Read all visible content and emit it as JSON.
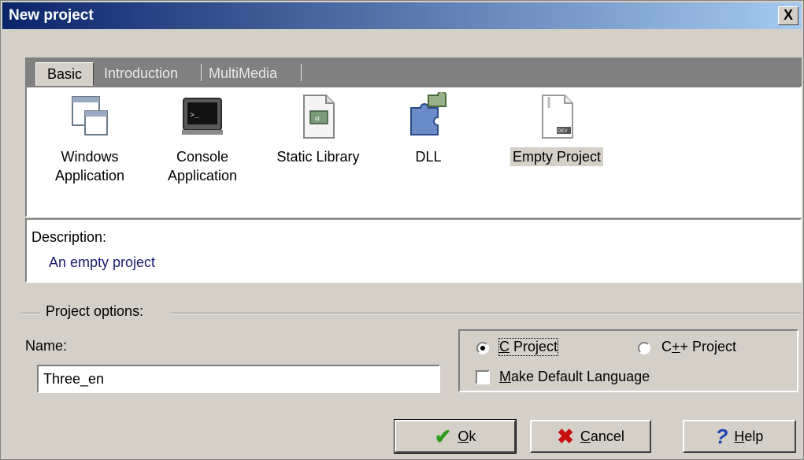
{
  "window": {
    "title": "New project",
    "close_label": "X"
  },
  "tabs": [
    {
      "label": "Basic",
      "active": true
    },
    {
      "label": "Introduction",
      "active": false
    },
    {
      "label": "MultiMedia",
      "active": false
    }
  ],
  "templates": [
    {
      "line1": "Windows",
      "line2": "Application",
      "icon": "window-icon",
      "selected": false
    },
    {
      "line1": "Console",
      "line2": "Application",
      "icon": "console-icon",
      "selected": false
    },
    {
      "line1": "Static Library",
      "line2": "",
      "icon": "library-icon",
      "selected": false
    },
    {
      "line1": "DLL",
      "line2": "",
      "icon": "puzzle-icon",
      "selected": false
    },
    {
      "line1": "Empty Project",
      "line2": "",
      "icon": "dev-file-icon",
      "selected": true
    }
  ],
  "description": {
    "label": "Description:",
    "value": "An empty project"
  },
  "options": {
    "group_label": "Project options:",
    "name_label": "Name:",
    "name_value": "Three_en",
    "c_project": {
      "prefix": "",
      "key": "C",
      "rest": " Project",
      "checked": true
    },
    "cpp_project": {
      "prefix": "C",
      "key": "+",
      "rest": "+ Project",
      "checked": false
    },
    "default_lang": {
      "prefix": "",
      "key": "M",
      "rest": "ake Default Language",
      "checked": false
    }
  },
  "buttons": {
    "ok": {
      "key": "O",
      "rest": "k"
    },
    "cancel": {
      "key": "C",
      "rest": "ancel"
    },
    "help": {
      "key": "H",
      "rest": "elp"
    }
  },
  "colors": {
    "title_start": "#0a246a",
    "title_end": "#a6caf0",
    "face": "#d4d0c8",
    "ok_check": "#2e9c1b",
    "cancel_x": "#c81010",
    "help_q": "#1c3fb5"
  }
}
